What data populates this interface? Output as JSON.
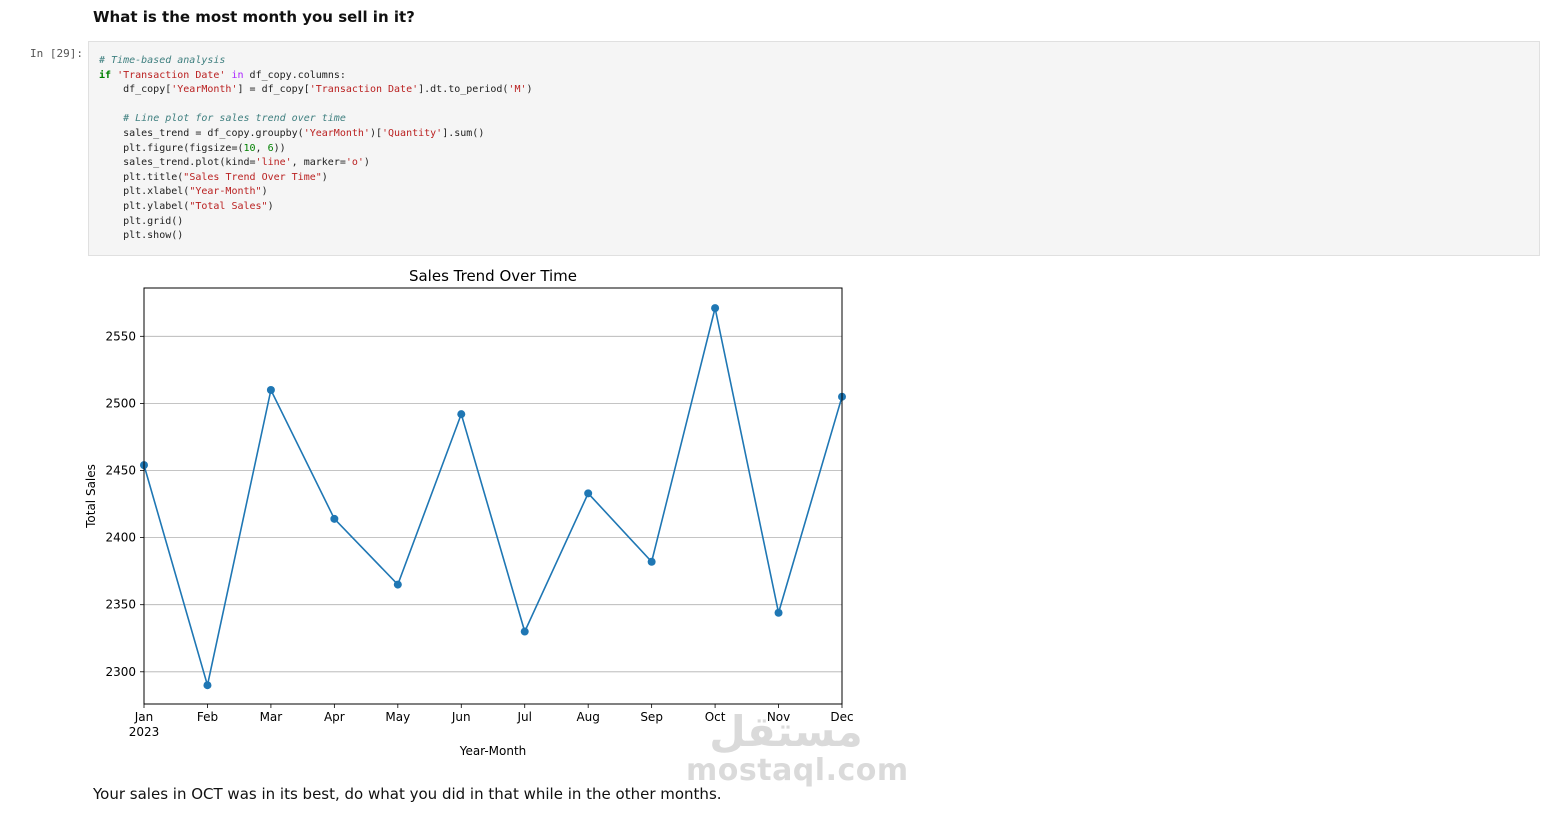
{
  "markdown": {
    "question": "What is the most month you sell in it?",
    "conclusion": "Your sales in OCT was in its best, do what you did in that while in the other months."
  },
  "cell": {
    "prompt": "In [29]:",
    "code_lines": [
      [
        {
          "t": "cm",
          "v": "# Time-based analysis"
        }
      ],
      [
        {
          "t": "kw",
          "v": "if"
        },
        {
          "t": "",
          "v": " "
        },
        {
          "t": "st",
          "v": "'Transaction Date'"
        },
        {
          "t": "",
          "v": " "
        },
        {
          "t": "op",
          "v": "in"
        },
        {
          "t": "",
          "v": " df_copy.columns:"
        }
      ],
      [
        {
          "t": "",
          "v": "    df_copy["
        },
        {
          "t": "st",
          "v": "'YearMonth'"
        },
        {
          "t": "",
          "v": "] = df_copy["
        },
        {
          "t": "st",
          "v": "'Transaction Date'"
        },
        {
          "t": "",
          "v": "].dt.to_period("
        },
        {
          "t": "st",
          "v": "'M'"
        },
        {
          "t": "",
          "v": ")"
        }
      ],
      [
        {
          "t": "",
          "v": ""
        }
      ],
      [
        {
          "t": "",
          "v": "    "
        },
        {
          "t": "cm",
          "v": "# Line plot for sales trend over time"
        }
      ],
      [
        {
          "t": "",
          "v": "    sales_trend = df_copy.groupby("
        },
        {
          "t": "st",
          "v": "'YearMonth'"
        },
        {
          "t": "",
          "v": ")["
        },
        {
          "t": "st",
          "v": "'Quantity'"
        },
        {
          "t": "",
          "v": "].sum()"
        }
      ],
      [
        {
          "t": "",
          "v": "    plt.figure(figsize=("
        },
        {
          "t": "nm",
          "v": "10"
        },
        {
          "t": "",
          "v": ", "
        },
        {
          "t": "nm",
          "v": "6"
        },
        {
          "t": "",
          "v": "))"
        }
      ],
      [
        {
          "t": "",
          "v": "    sales_trend.plot(kind="
        },
        {
          "t": "st",
          "v": "'line'"
        },
        {
          "t": "",
          "v": ", marker="
        },
        {
          "t": "st",
          "v": "'o'"
        },
        {
          "t": "",
          "v": ")"
        }
      ],
      [
        {
          "t": "",
          "v": "    plt.title("
        },
        {
          "t": "st",
          "v": "\"Sales Trend Over Time\""
        },
        {
          "t": "",
          "v": ")"
        }
      ],
      [
        {
          "t": "",
          "v": "    plt.xlabel("
        },
        {
          "t": "st",
          "v": "\"Year-Month\""
        },
        {
          "t": "",
          "v": ")"
        }
      ],
      [
        {
          "t": "",
          "v": "    plt.ylabel("
        },
        {
          "t": "st",
          "v": "\"Total Sales\""
        },
        {
          "t": "",
          "v": ")"
        }
      ],
      [
        {
          "t": "",
          "v": "    plt.grid()"
        }
      ],
      [
        {
          "t": "",
          "v": "    plt.show()"
        }
      ]
    ]
  },
  "watermark": {
    "arabic": "مستقل",
    "latin": "mostaql.com"
  },
  "chart_data": {
    "type": "line",
    "title": "Sales Trend Over Time",
    "xlabel": "Year-Month",
    "ylabel": "Total Sales",
    "categories": [
      "Jan",
      "Feb",
      "Mar",
      "Apr",
      "May",
      "Jun",
      "Jul",
      "Aug",
      "Sep",
      "Oct",
      "Nov",
      "Dec"
    ],
    "year_label": "2023",
    "values": [
      2454,
      2290,
      2510,
      2414,
      2365,
      2492,
      2330,
      2433,
      2382,
      2571,
      2344,
      2505
    ],
    "yticks": [
      2300,
      2350,
      2400,
      2450,
      2500,
      2550
    ],
    "ylim": [
      2276,
      2586
    ],
    "grid": "horizontal",
    "marker": "circle",
    "line_color": "#1f77b4"
  }
}
